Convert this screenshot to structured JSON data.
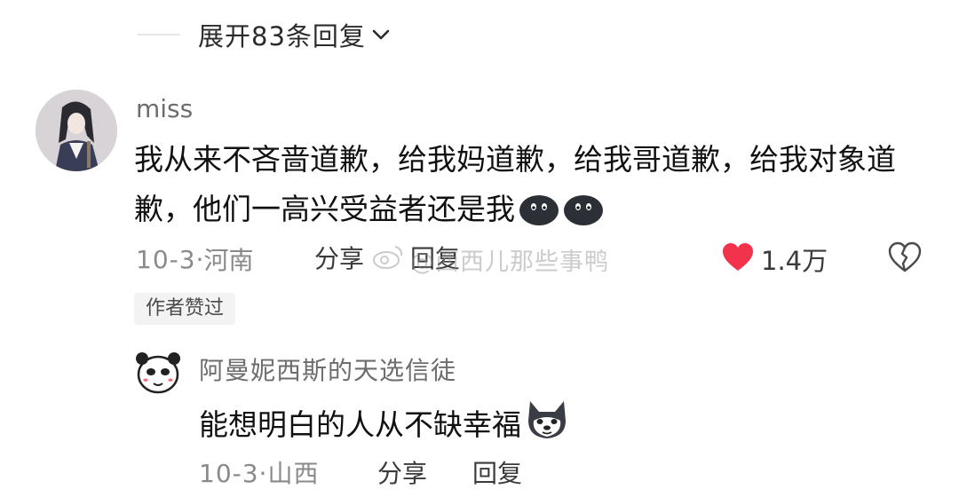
{
  "expand_replies": {
    "label": "展开83条回复"
  },
  "comment": {
    "username": "miss",
    "text": "我从来不吝啬道歉，给我妈道歉，给我哥道歉，给我对象道歉，他们一高兴受益者还是我",
    "emojis": [
      "blob-emoji",
      "blob-emoji"
    ],
    "date": "10-3",
    "location": "河南",
    "share_label": "分享",
    "reply_label": "回复",
    "like_count": "1.4万",
    "liked": true,
    "author_badge": "作者赞过"
  },
  "watermark": {
    "text": "@西西儿那些事鸭"
  },
  "reply": {
    "username": "阿曼妮西斯的天选信徒",
    "text": "能想明白的人从不缺幸福",
    "emoji": "husky-emoji",
    "date": "10-3",
    "location": "山西",
    "share_label": "分享",
    "reply_label": "回复"
  },
  "colors": {
    "like_red": "#f2334b",
    "meta_gray": "#8a8a8a",
    "text_dark": "#111111"
  }
}
